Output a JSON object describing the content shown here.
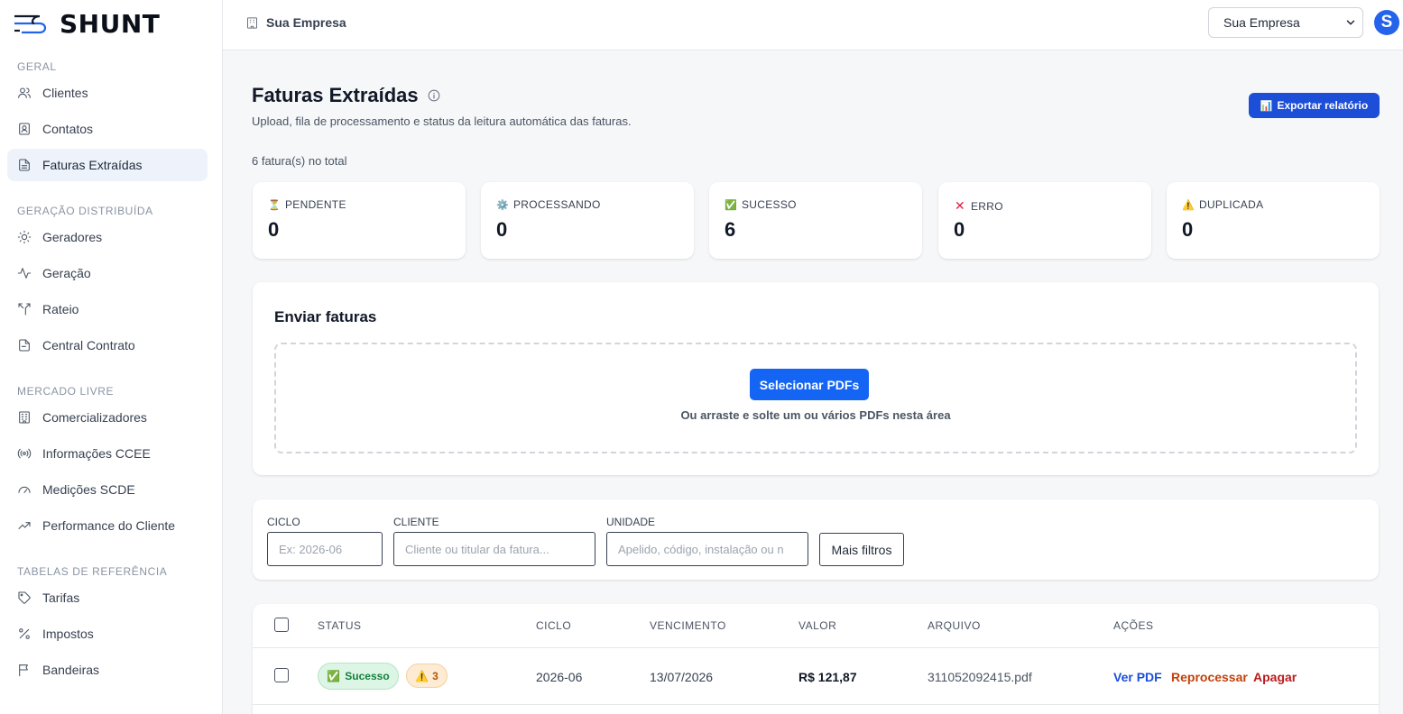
{
  "app": {
    "logo_text": "SHUNT"
  },
  "sidebar": {
    "sections": [
      {
        "title": "GERAL"
      },
      {
        "title": "GERAÇÃO DISTRIBUÍDA"
      },
      {
        "title": "MERCADO LIVRE"
      },
      {
        "title": "TABELAS DE REFERÊNCIA"
      }
    ],
    "items": [
      {
        "label": "Clientes",
        "icon": "users-icon"
      },
      {
        "label": "Contatos",
        "icon": "contact-icon"
      },
      {
        "label": "Faturas Extraídas",
        "icon": "document-icon",
        "active": true
      },
      {
        "label": "Geradores",
        "icon": "sun-icon"
      },
      {
        "label": "Geração",
        "icon": "activity-icon"
      },
      {
        "label": "Rateio",
        "icon": "split-icon"
      },
      {
        "label": "Central Contrato",
        "icon": "file-icon"
      },
      {
        "label": "Comercializadores",
        "icon": "building-icon"
      },
      {
        "label": "Informações CCEE",
        "icon": "radio-icon"
      },
      {
        "label": "Medições SCDE",
        "icon": "gauge-icon"
      },
      {
        "label": "Performance do Cliente",
        "icon": "trending-icon"
      },
      {
        "label": "Tarifas",
        "icon": "tag-icon"
      },
      {
        "label": "Impostos",
        "icon": "percent-icon"
      },
      {
        "label": "Bandeiras",
        "icon": "flag-icon"
      }
    ]
  },
  "header": {
    "company": "Sua Empresa",
    "company_select": "Sua Empresa",
    "avatar_letter": "S"
  },
  "page": {
    "title": "Faturas Extraídas",
    "subtitle": "Upload, fila de processamento e status da leitura automática das faturas.",
    "export_label": "Exportar relatório",
    "total": "6 fatura(s) no total"
  },
  "stats": [
    {
      "label": "PENDENTE",
      "value": "0",
      "icon": "hourglass-icon"
    },
    {
      "label": "PROCESSANDO",
      "value": "0",
      "icon": "gear-icon"
    },
    {
      "label": "SUCESSO",
      "value": "6",
      "icon": "check-icon"
    },
    {
      "label": "ERRO",
      "value": "0",
      "icon": "x-icon"
    },
    {
      "label": "DUPLICADA",
      "value": "0",
      "icon": "warning-icon"
    }
  ],
  "upload": {
    "title": "Enviar faturas",
    "button": "Selecionar PDFs",
    "hint": "Ou arraste e solte um ou vários PDFs nesta área"
  },
  "filters": {
    "ciclo_label": "CICLO",
    "ciclo_placeholder": "Ex: 2026-06",
    "cliente_label": "CLIENTE",
    "cliente_placeholder": "Cliente ou titular da fatura...",
    "unidade_label": "UNIDADE",
    "unidade_placeholder": "Apelido, código, instalação ou n",
    "more_label": "Mais filtros"
  },
  "table": {
    "columns": [
      "STATUS",
      "CICLO",
      "VENCIMENTO",
      "VALOR",
      "ARQUIVO",
      "AÇÕES"
    ],
    "rows": [
      {
        "status": "Sucesso",
        "warnings": "3",
        "ciclo": "2026-06",
        "vencimento": "13/07/2026",
        "valor": "R$ 121,87",
        "arquivo": "311052092415.pdf",
        "actions": {
          "view": "Ver PDF",
          "reprocess": "Reprocessar",
          "delete": "Apagar"
        }
      }
    ]
  },
  "colors": {
    "primary": "#1d4ed8",
    "upload_button": "#1565f5",
    "view_link": "#1d4ed8",
    "reprocess_link": "#c2410c",
    "delete_link": "#b91c1c",
    "success": "#15803d"
  }
}
